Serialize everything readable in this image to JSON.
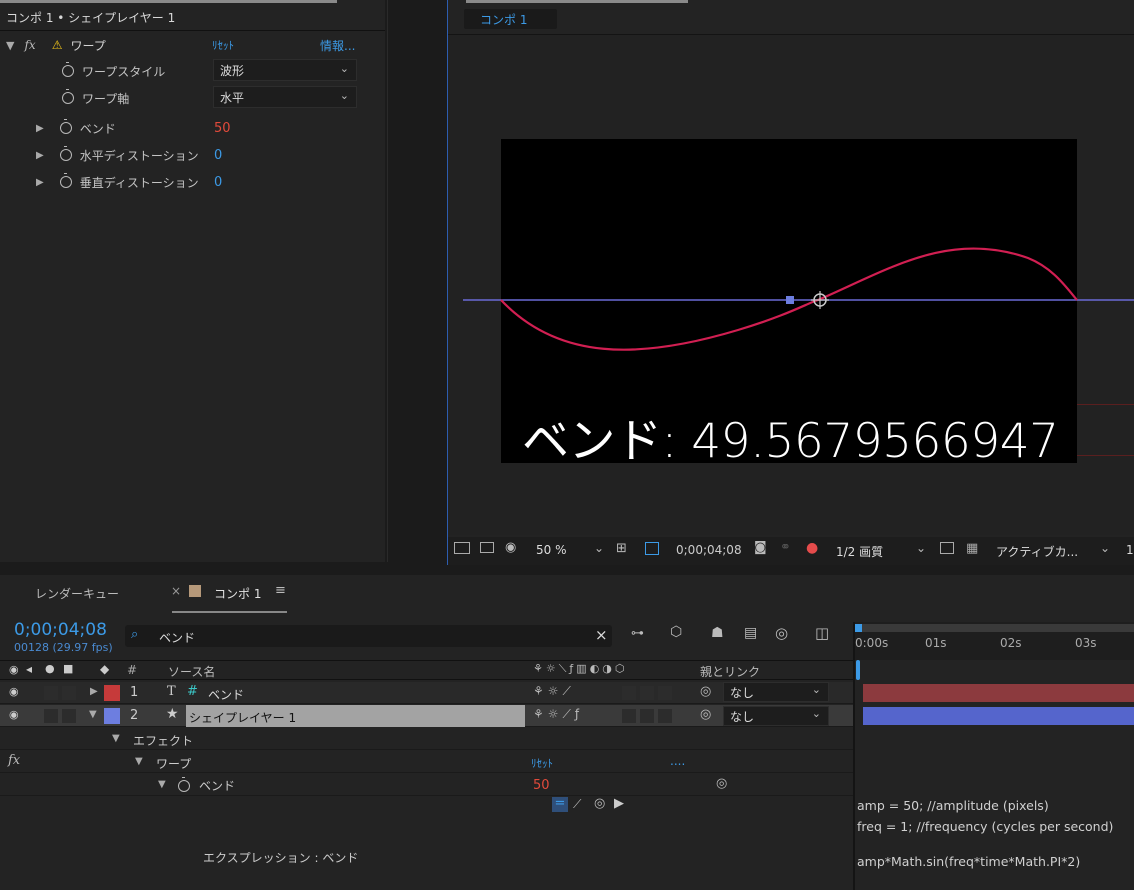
{
  "effect_controls": {
    "title": "コンポ 1 • シェイプレイヤー 1",
    "effect_name": "ワープ",
    "reset": "ﾘｾｯﾄ",
    "info": "情報...",
    "props": [
      {
        "label": "ワープスタイル",
        "value": "波形"
      },
      {
        "label": "ワープ軸",
        "value": "水平"
      },
      {
        "label": "ベンド",
        "value": "50"
      },
      {
        "label": "水平ディストーション",
        "value": "0"
      },
      {
        "label": "垂直ディストーション",
        "value": "0"
      }
    ]
  },
  "viewer": {
    "tab": "コンポ 1",
    "overlay_text": "ベンド: 49.5679566947",
    "zoom": "50 %",
    "timecode": "0;00;04;08",
    "quality": "1/2 画質",
    "camera": "アクティブカ...",
    "last": "1"
  },
  "timeline": {
    "tabs": {
      "render": "レンダーキュー",
      "comp": "コンポ 1"
    },
    "timecode": "0;00;04;08",
    "frames": "00128 (29.97 fps)",
    "search": "ベンド",
    "cols": {
      "num": "#",
      "source": "ソース名",
      "parent": "親とリンク"
    },
    "ruler": [
      "0:00s",
      "01s",
      "02s",
      "03s"
    ],
    "layers": [
      {
        "num": "1",
        "name": "ベンド",
        "parent": "なし",
        "color": "#c63a3a"
      },
      {
        "num": "2",
        "name": "シェイプレイヤー 1",
        "parent": "なし",
        "color": "#6d7ee0"
      }
    ],
    "effect_group": "エフェクト",
    "warp": "ワープ",
    "reset": "ﾘｾｯﾄ",
    "dots": "....",
    "bend": "ベンド",
    "bend_value": "50",
    "expression_label": "エクスプレッション : ベンド",
    "expression": [
      "amp = 50; //amplitude (pixels)",
      "freq = 1; //frequency (cycles per second)",
      "",
      "amp*Math.sin(freq*time*Math.PI*2)"
    ]
  }
}
